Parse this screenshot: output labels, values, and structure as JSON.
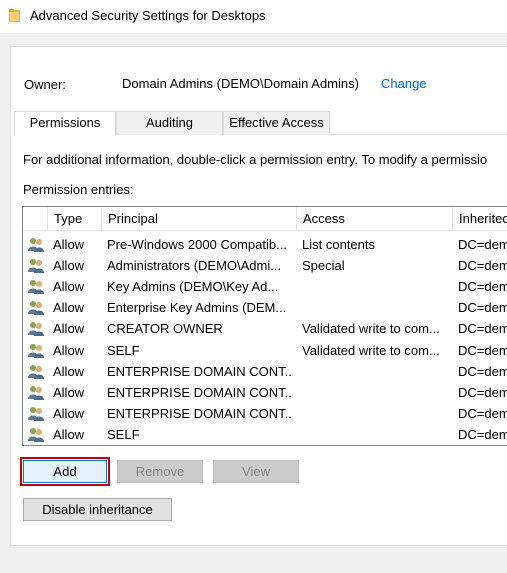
{
  "window": {
    "title": "Advanced Security Settings for Desktops"
  },
  "owner": {
    "label": "Owner:",
    "value": "Domain Admins (DEMO\\Domain Admins)",
    "change_link": "Change"
  },
  "tabs": [
    {
      "label": "Permissions",
      "active": true
    },
    {
      "label": "Auditing",
      "active": false
    },
    {
      "label": "Effective Access",
      "active": false
    }
  ],
  "info_text": "For additional information, double-click a permission entry. To modify a permissio",
  "entries_label": "Permission entries:",
  "table": {
    "columns": [
      "Type",
      "Principal",
      "Access",
      "Inherited"
    ],
    "rows": [
      {
        "type": "Allow",
        "principal": "Pre-Windows 2000 Compatib...",
        "access": "List contents",
        "inherited": "DC=dem"
      },
      {
        "type": "Allow",
        "principal": "Administrators (DEMO\\Admi...",
        "access": "Special",
        "inherited": "DC=dem"
      },
      {
        "type": "Allow",
        "principal": "Key Admins (DEMO\\Key Ad...",
        "access": "",
        "inherited": "DC=dem"
      },
      {
        "type": "Allow",
        "principal": "Enterprise Key Admins (DEM...",
        "access": "",
        "inherited": "DC=dem"
      },
      {
        "type": "Allow",
        "principal": "CREATOR OWNER",
        "access": "Validated write to com...",
        "inherited": "DC=dem"
      },
      {
        "type": "Allow",
        "principal": "SELF",
        "access": "Validated write to com...",
        "inherited": "DC=dem"
      },
      {
        "type": "Allow",
        "principal": "ENTERPRISE DOMAIN CONT...",
        "access": "",
        "inherited": "DC=dem"
      },
      {
        "type": "Allow",
        "principal": "ENTERPRISE DOMAIN CONT...",
        "access": "",
        "inherited": "DC=dem"
      },
      {
        "type": "Allow",
        "principal": "ENTERPRISE DOMAIN CONT...",
        "access": "",
        "inherited": "DC=dem"
      },
      {
        "type": "Allow",
        "principal": "SELF",
        "access": "",
        "inherited": "DC=dem"
      }
    ]
  },
  "buttons": {
    "add": "Add",
    "remove": "Remove",
    "view": "View",
    "disable_inheritance": "Disable inheritance"
  },
  "icons": {
    "title": "folder-icon",
    "row": "users-icon"
  },
  "colors": {
    "link": "#0066cc",
    "highlight": "#c00000"
  }
}
